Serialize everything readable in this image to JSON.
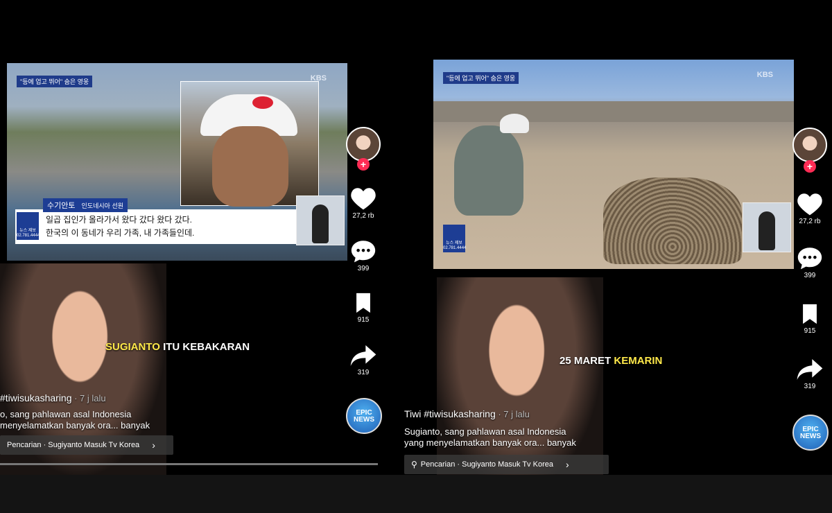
{
  "left": {
    "news": {
      "tag": "\"등에 업고 뛰어\" 숨은 영웅",
      "channel": "KBS",
      "speaker_name": "수기안토",
      "speaker_role": "인도네시아 선원",
      "subtitle_line1": "일곱 집인가 올라가서 왔다 갔다 왔다 갔다.",
      "subtitle_line2": "한국의 이 동네가 우리 가족, 내 가족들인데.",
      "chip_text": "뉴스 제보 02.781.4444"
    },
    "caption_white_after": " ITU KEBAKARAN",
    "caption_yellow": "SUGIANTO",
    "meta": {
      "username": "#tiwisukasharing",
      "time": " · 7 j lalu"
    },
    "description_line1": "o, sang pahlawan asal Indonesia",
    "description_line2": "menyelamatkan banyak ora... banyak",
    "search_chip": "Pencarian · Sugiyanto Masuk Tv Korea",
    "progress": 1.0
  },
  "right": {
    "news": {
      "tag": "\"등에 업고 뛰어\" 숨은 영웅",
      "channel": "KBS",
      "chip_text": "뉴스 제보 02.781.4444"
    },
    "caption_white": "25 MARET ",
    "caption_yellow": "KEMARIN",
    "meta": {
      "username": "Tiwi #tiwisukasharing",
      "time": " · 7 j lalu"
    },
    "description_line1": "Sugianto, sang pahlawan asal Indonesia",
    "description_line2": "yang menyelamatkan banyak ora... banyak",
    "search_chip": "Pencarian · Sugiyanto Masuk Tv Korea"
  },
  "rail": {
    "likes": "27,2 rb",
    "comments": "399",
    "saves": "915",
    "shares": "319",
    "plus": "+",
    "epic_line1": "EPIC",
    "epic_line2": "NEWS"
  },
  "colors": {
    "accent_red": "#fe2c55",
    "caption_yellow": "#ffe94a",
    "news_blue": "#1d3d94"
  }
}
